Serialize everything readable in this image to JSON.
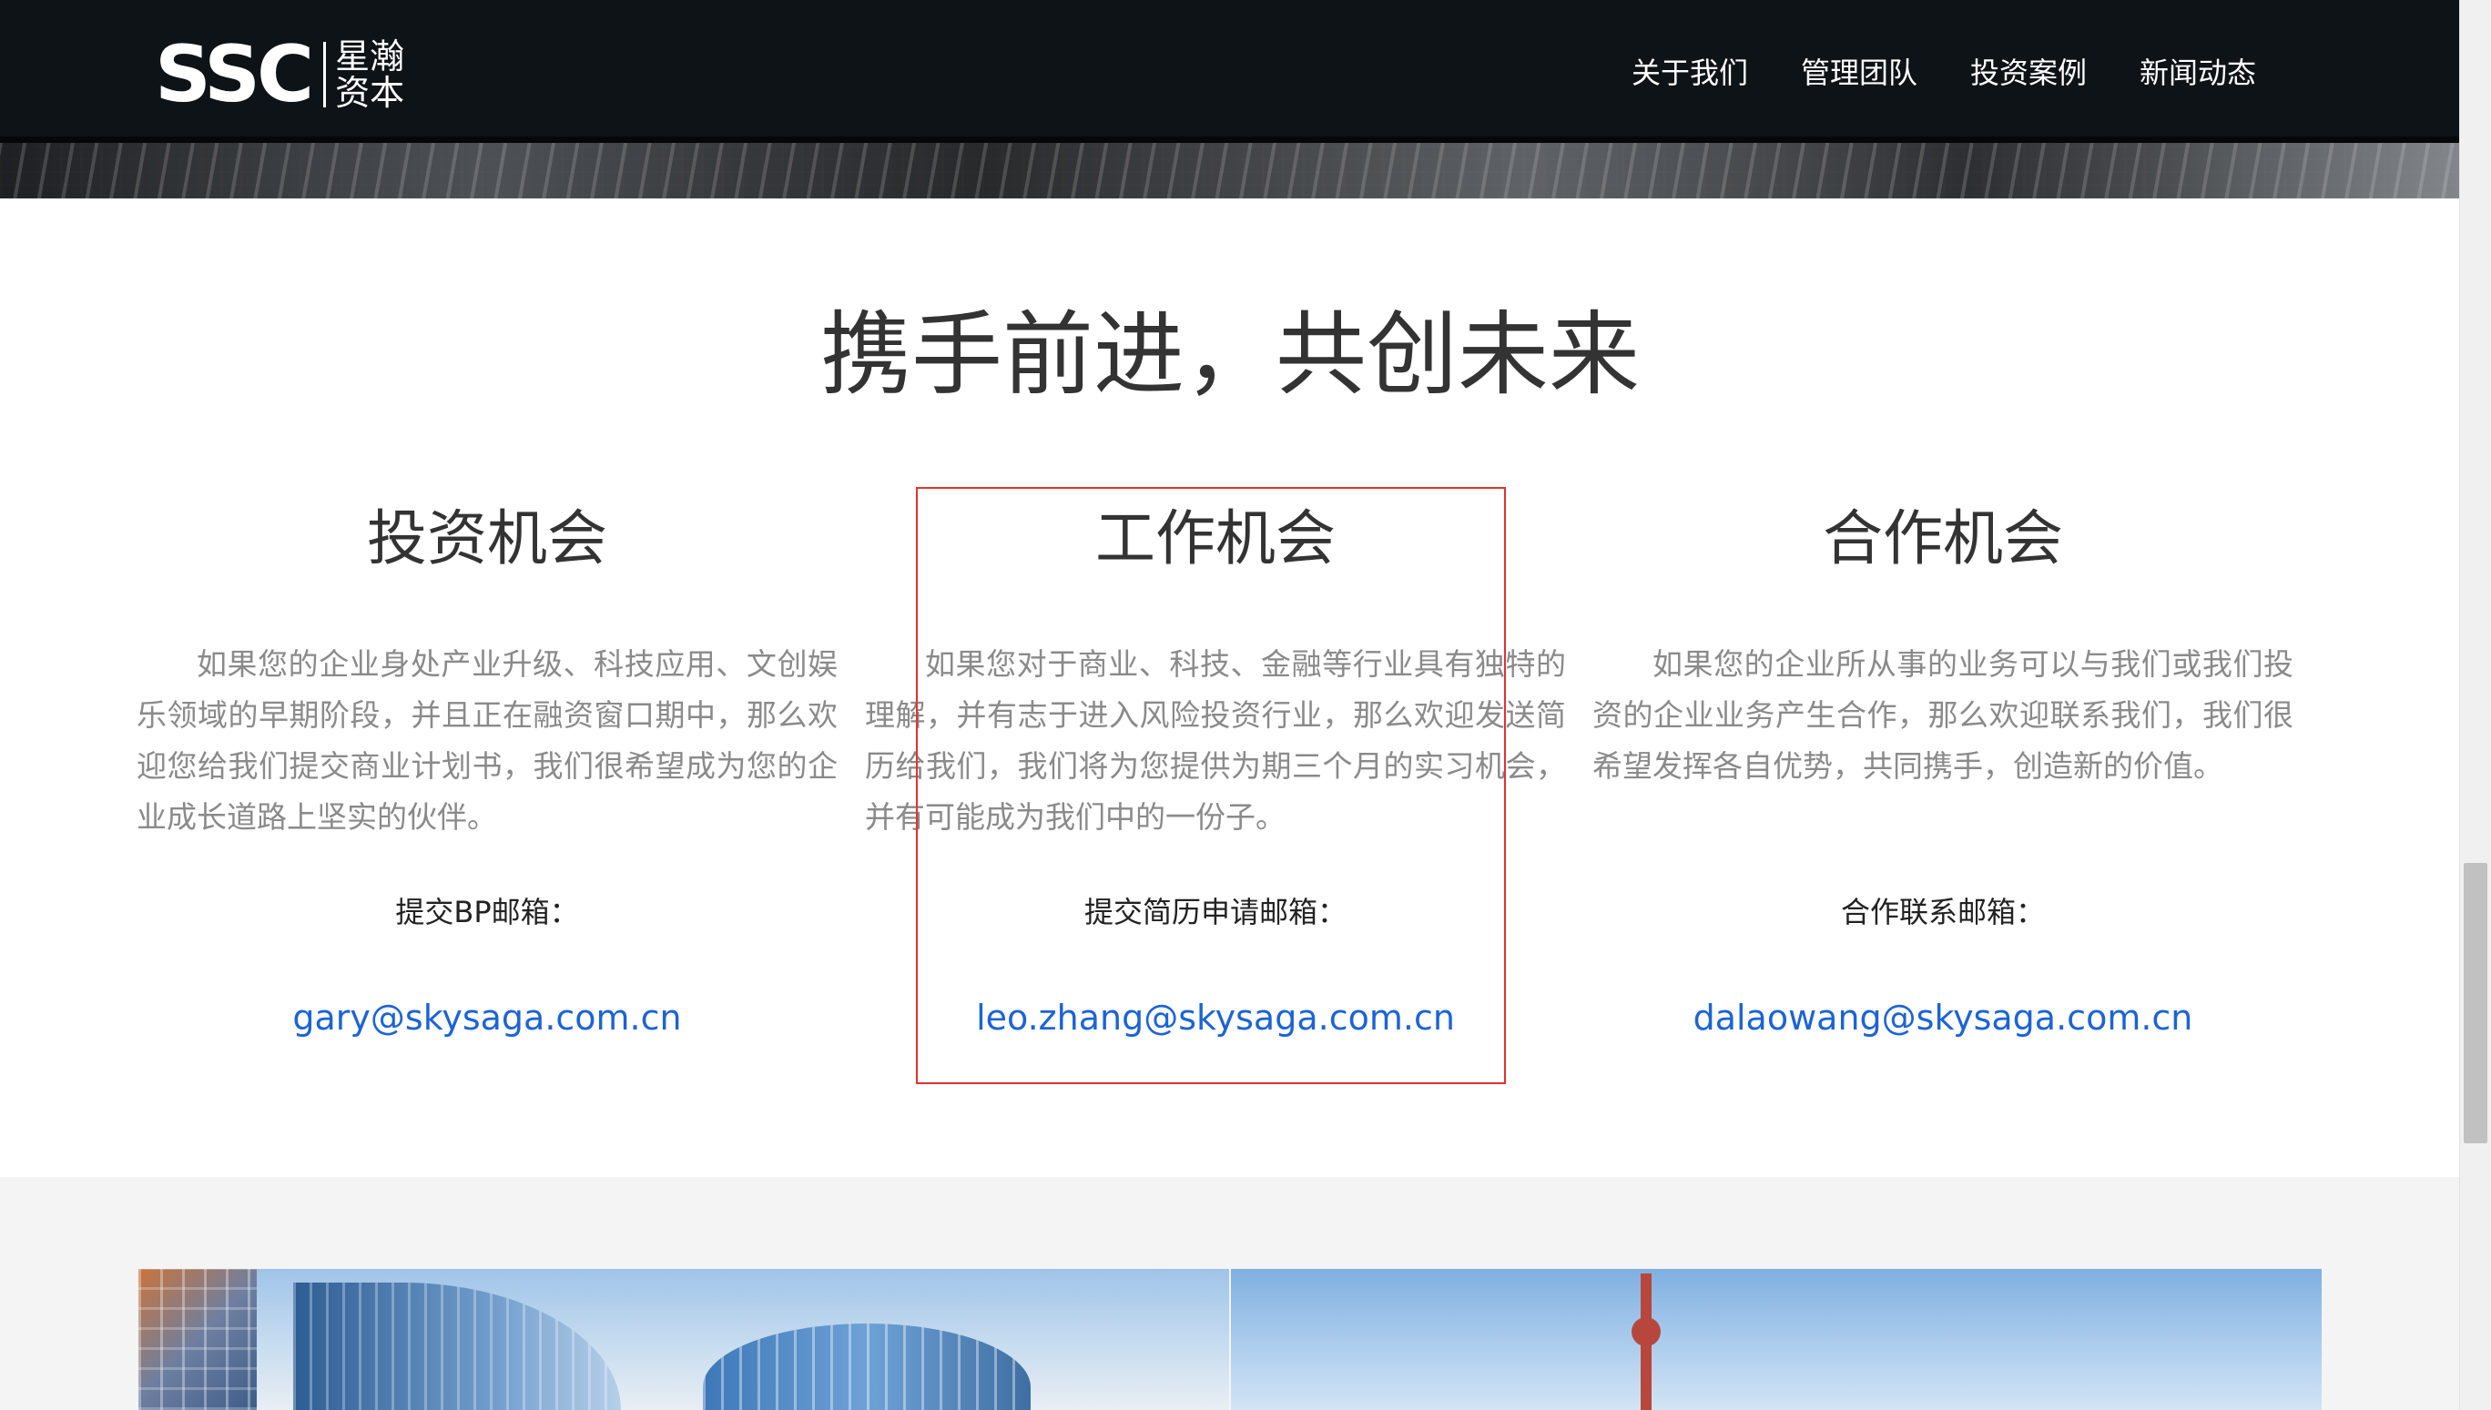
{
  "header": {
    "logo_mark": "SSC",
    "logo_cn_line1": "星瀚",
    "logo_cn_line2": "资本",
    "nav": [
      {
        "label": "关于我们"
      },
      {
        "label": "管理团队"
      },
      {
        "label": "投资案例"
      },
      {
        "label": "新闻动态"
      }
    ]
  },
  "main": {
    "title": "携手前进，共创未来",
    "columns": [
      {
        "title": "投资机会",
        "description": "如果您的企业身处产业升级、科技应用、文创娱乐领域的早期阶段，并且正在融资窗口期中，那么欢迎您给我们提交商业计划书，我们很希望成为您的企业成长道路上坚实的伙伴。",
        "email_label": "提交BP邮箱：",
        "email": "gary@skysaga.com.cn"
      },
      {
        "title": "工作机会",
        "description": "如果您对于商业、科技、金融等行业具有独特的理解，并有志于进入风险投资行业，那么欢迎发送简历给我们，我们将为您提供为期三个月的实习机会，并有可能成为我们中的一份子。",
        "email_label": "提交简历申请邮箱：",
        "email": "leo.zhang@skysaga.com.cn"
      },
      {
        "title": "合作机会",
        "description": "如果您的企业所从事的业务可以与我们或我们投资的企业业务产生合作，那么欢迎联系我们，我们很希望发挥各自优势，共同携手，创造新的价值。",
        "email_label": "合作联系邮箱：",
        "email": "dalaowang@skysaga.com.cn"
      }
    ]
  },
  "colors": {
    "navbar_bg": "#0e1317",
    "title_text": "#333333",
    "body_text": "#8a8a8a",
    "link": "#1c63d6",
    "highlight_border": "#e53030"
  }
}
